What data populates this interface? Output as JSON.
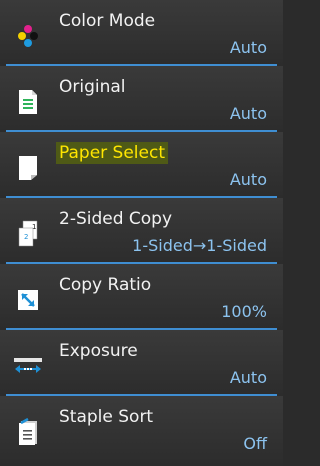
{
  "items": [
    {
      "label": "Color Mode",
      "value": "Auto",
      "icon": "color-mode-icon"
    },
    {
      "label": "Original",
      "value": "Auto",
      "icon": "original-icon"
    },
    {
      "label": "Paper Select",
      "value": "Auto",
      "icon": "paper-icon",
      "highlighted": true
    },
    {
      "label": "2-Sided Copy",
      "value": "1-Sided→1-Sided",
      "icon": "two-sided-icon"
    },
    {
      "label": "Copy Ratio",
      "value": "100%",
      "icon": "copy-ratio-icon"
    },
    {
      "label": "Exposure",
      "value": "Auto",
      "icon": "exposure-icon"
    },
    {
      "label": "Staple Sort",
      "value": "Off",
      "icon": "staple-sort-icon"
    }
  ],
  "colors": {
    "separator": "#3f8ed2",
    "value_text": "#8cc3ef",
    "highlight_bg": "#4f5a16",
    "highlight_text": "#ffe600"
  }
}
